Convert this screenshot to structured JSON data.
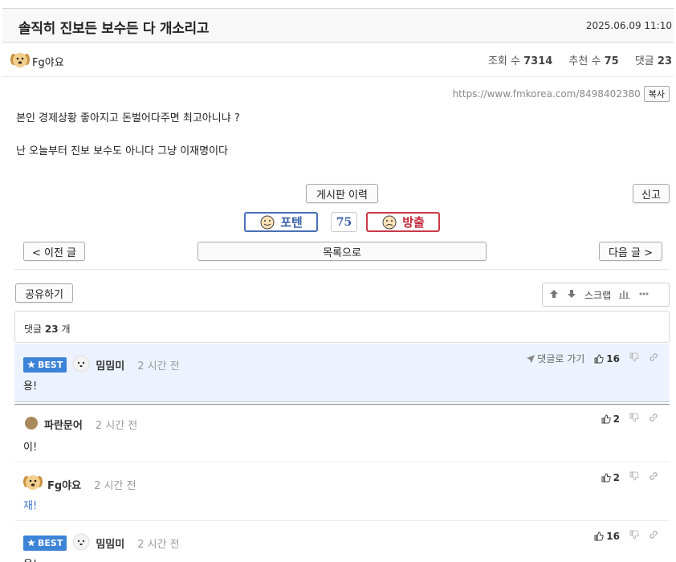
{
  "post": {
    "title": "솔직히 진보든 보수든 다 개소리고",
    "date": "2025.06.09 11:10",
    "author": "Fg야요",
    "views_label": "조회 수",
    "views": "7314",
    "recommends_label": "추천 수",
    "recommends": "75",
    "comments_label": "댓글",
    "comments": "23",
    "url": "https://www.fmkorea.com/8498402380",
    "copy_label": "복사",
    "body": [
      "본인 경제상황 좋아지고 돈벌어다주면 최고아니냐 ?",
      "난 오늘부터 진보 보수도 아니다 그냥 이재명이다"
    ]
  },
  "actions": {
    "history_label": "게시판 이력",
    "report_label": "신고",
    "vote_up_label": "포텐",
    "vote_count": "75",
    "vote_down_label": "방출",
    "prev_label": "< 이전 글",
    "list_label": "목록으로",
    "next_label": "다음 글 >",
    "share_label": "공유하기",
    "scrap_label": "스크랩"
  },
  "comments_header": {
    "prefix": "댓글",
    "count": "23",
    "suffix": "개"
  },
  "comments": [
    {
      "best": true,
      "badge": "BEST",
      "name": "밈밈미",
      "time": "2 시간 전",
      "goto": "댓글로 가기",
      "likes": "16",
      "text": "용!"
    },
    {
      "best": false,
      "name": "파란문어",
      "time": "2 시간 전",
      "likes": "2",
      "text": "이!"
    },
    {
      "best": false,
      "name": "Fg야요",
      "time": "2 시간 전",
      "likes": "2",
      "text": "재!"
    },
    {
      "best": true,
      "badge": "BEST",
      "name": "밈밈미",
      "time": "2 시간 전",
      "likes": "16",
      "text": "용!"
    }
  ],
  "colors": {
    "best_bg": "#edf3fe",
    "badge": "#3d83d8",
    "vote_up": "#3a5fa8",
    "vote_down": "#c3283a"
  }
}
